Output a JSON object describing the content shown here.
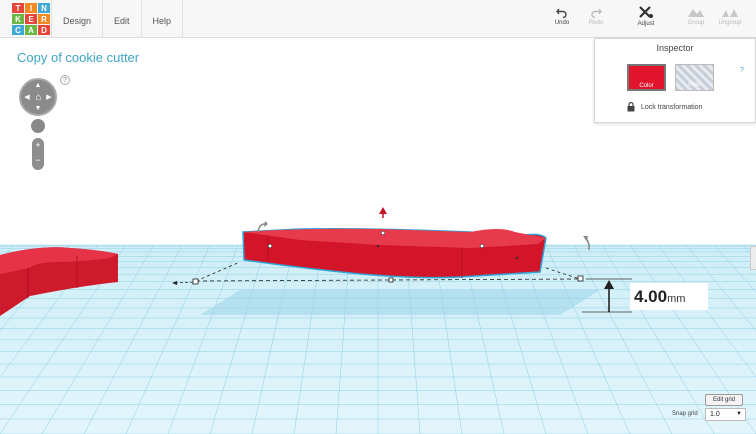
{
  "logo": {
    "letters": [
      "T",
      "I",
      "N",
      "K",
      "E",
      "R",
      "C",
      "A",
      "D"
    ],
    "colors": [
      "#e7443a",
      "#f28a1f",
      "#3fa9d6",
      "#6cb743",
      "#e7443a",
      "#f28a1f",
      "#3fa9d6",
      "#6cb743",
      "#e7443a"
    ]
  },
  "menu": {
    "items": [
      {
        "label": "Design"
      },
      {
        "label": "Edit"
      },
      {
        "label": "Help"
      }
    ]
  },
  "toolbar": {
    "undo": "Undo",
    "redo": "Redo",
    "adjust": "Adjust",
    "group": "Group",
    "ungroup": "Ungroup"
  },
  "project": {
    "title": "Copy of cookie cutter"
  },
  "help_mark": "?",
  "inspector": {
    "title": "Inspector",
    "color_label": "Color",
    "hole_label": "Hole",
    "lock_label": "Lock transformation",
    "help": "?"
  },
  "dimension": {
    "value": "4.00",
    "unit": "mm"
  },
  "grid": {
    "edit_label": "Edit grid",
    "snap_label": "Snap grid",
    "snap_value": "1.0"
  },
  "icons": {
    "undo": "undo-icon",
    "redo": "redo-icon",
    "adjust": "adjust-icon",
    "group": "group-icon",
    "ungroup": "ungroup-icon",
    "lock": "lock-icon",
    "home": "home-icon"
  },
  "colors": {
    "accent": "#3da5c5",
    "shape_red": "#e2152d",
    "grid_blue": "#bfe6f3"
  }
}
